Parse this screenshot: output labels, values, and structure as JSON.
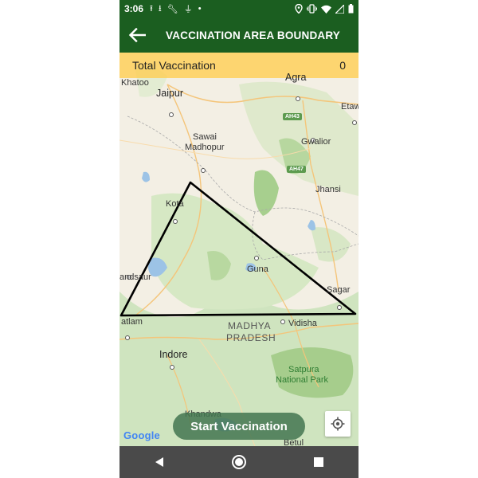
{
  "status_bar": {
    "time": "3:06",
    "left_icons": [
      "upload-icon",
      "download-icon",
      "wrench-icon",
      "usb-icon",
      "dot-icon"
    ],
    "right_icons": [
      "location-icon",
      "vibrate-icon",
      "wifi-icon",
      "signal-icon",
      "battery-icon"
    ]
  },
  "app_bar": {
    "title": "VACCINATION AREA BOUNDARY"
  },
  "summary": {
    "total_label": "Total Vaccination",
    "total_value": "0"
  },
  "map": {
    "cities": {
      "khatoo": "Khatoo",
      "jaipur": "Jaipur",
      "agra": "Agra",
      "etawah": "Etaw",
      "sawai_madhopur_1": "Sawai",
      "sawai_madhopur_2": "Madhopur",
      "gwalior": "Gwalior",
      "jhansi": "Jhansi",
      "kota": "Kota",
      "mandsaur": "andsaur",
      "guna": "Guna",
      "sagar": "Sagar",
      "ratlam": "atlam",
      "vidisha": "Vidisha",
      "indore": "Indore",
      "khandwa": "Khandwa",
      "betul": "Betul"
    },
    "state_label_1": "MADHYA",
    "state_label_2": "PRADESH",
    "park_label_1": "Satpura",
    "park_label_2": "National Park",
    "highway_1": "AH43",
    "highway_2": "AH47",
    "attribution": "Google",
    "boundary_color": "#000000"
  },
  "actions": {
    "start_label": "Start Vaccination"
  },
  "nav": {
    "back": "back-icon",
    "home": "home-icon",
    "recents": "recents-icon"
  },
  "colors": {
    "primary": "#1b5e20",
    "summary_bar": "#ffcd50",
    "button": "#437650"
  }
}
